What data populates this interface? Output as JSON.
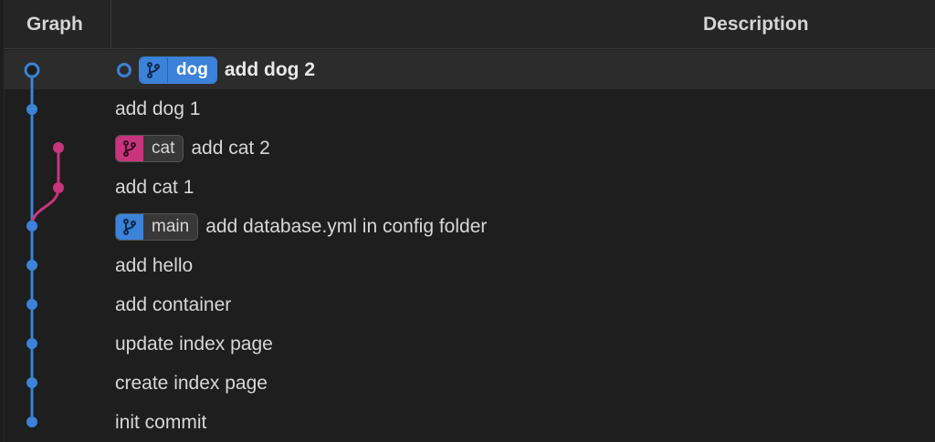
{
  "header": {
    "graph_label": "Graph",
    "description_label": "Description"
  },
  "colors": {
    "main_line": "#3b82d8",
    "cat_line": "#c8357c"
  },
  "commits": [
    {
      "message": "add dog 2",
      "current": true,
      "branch": {
        "name": "dog",
        "color": "#3b82d8",
        "icon": "git-branch-icon"
      }
    },
    {
      "message": "add dog 1"
    },
    {
      "message": "add cat 2",
      "branch": {
        "name": "cat",
        "color": "#c8357c",
        "icon": "git-branch-icon"
      }
    },
    {
      "message": "add cat 1"
    },
    {
      "message": "add database.yml in config folder",
      "branch": {
        "name": "main",
        "color": "#3b82d8",
        "icon": "git-branch-icon"
      }
    },
    {
      "message": "add hello"
    },
    {
      "message": "add container"
    },
    {
      "message": "update index page"
    },
    {
      "message": "create index page"
    },
    {
      "message": "init commit"
    }
  ]
}
